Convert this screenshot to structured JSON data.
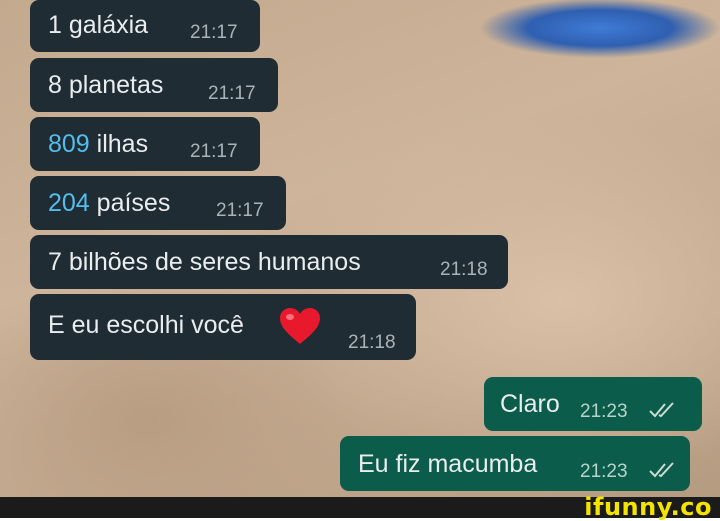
{
  "messages": [
    {
      "id": "m1",
      "number": "1",
      "text": " galáxia",
      "time": "21:17"
    },
    {
      "id": "m2",
      "number": "8",
      "text": " planetas",
      "time": "21:17"
    },
    {
      "id": "m3",
      "number": "809",
      "text": " ilhas",
      "time": "21:17"
    },
    {
      "id": "m4",
      "number": "204",
      "text": " países",
      "time": "21:17"
    },
    {
      "id": "m5",
      "text": "7 bilhões de seres humanos",
      "time": "21:18"
    },
    {
      "id": "m6",
      "text": "E eu escolhi você",
      "emoji": "heart-emoji",
      "time": "21:18"
    },
    {
      "id": "m7",
      "text": "Claro",
      "time": "21:23",
      "status": "read"
    },
    {
      "id": "m8",
      "text": "Eu fiz macumba",
      "time": "21:23",
      "status": "read"
    }
  ],
  "footer": {
    "brand": "ifunny.co"
  },
  "colors": {
    "incoming_bubble": "#1f2c33",
    "outgoing_bubble": "#0b5c4a",
    "link": "#53bdeb",
    "brand": "#f5e400"
  }
}
